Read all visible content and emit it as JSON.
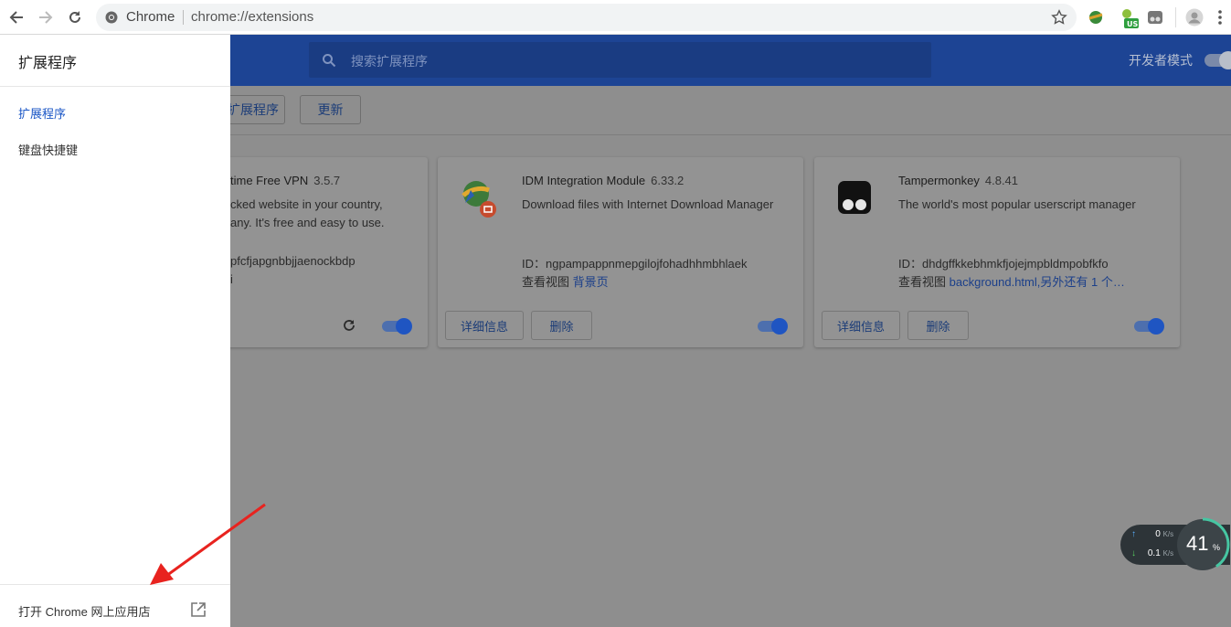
{
  "browser": {
    "site_name": "Chrome",
    "url": "chrome://extensions"
  },
  "header": {
    "search_placeholder": "搜索扩展程序",
    "dev_mode_label": "开发者模式"
  },
  "subbar": {
    "load_label": "扩展程序",
    "update_label": "更新"
  },
  "drawer": {
    "title": "扩展程序",
    "items": [
      {
        "label": "扩展程序"
      },
      {
        "label": "键盘快捷键"
      }
    ],
    "footer_label": "打开 Chrome 网上应用店"
  },
  "cards": [
    {
      "name": "time Free VPN",
      "version": "3.5.7",
      "desc_line1": "cked website in your country,",
      "desc_line2": "any. It's free and easy to use.",
      "id_text": "pfcfjapgnbbjjaenockbdp",
      "view_text": "i",
      "enabled": true
    },
    {
      "name": "IDM Integration Module",
      "version": "6.33.2",
      "desc": "Download files with Internet Download Manager",
      "id_label": "ID：",
      "id_text": "ngpampappnmepgilojfohadhhmbhlaek",
      "view_label": "查看视图",
      "view_link": "背景页",
      "details_label": "详细信息",
      "remove_label": "删除",
      "enabled": true
    },
    {
      "name": "Tampermonkey",
      "version": "4.8.41",
      "desc": "The world's most popular userscript manager",
      "id_label": "ID：",
      "id_text": "dhdgffkkebhmkfjojejmpbldmpobfkfo",
      "view_label": "查看视图",
      "view_link": "background.html,另外还有 1 个…",
      "details_label": "详细信息",
      "remove_label": "删除",
      "enabled": true
    }
  ],
  "netspeed": {
    "up_value": "0",
    "up_unit": "K/s",
    "down_value": "0.1",
    "down_unit": "K/s",
    "cpu_value": "41",
    "cpu_unit": "%"
  },
  "colors": {
    "header_blue": "#1d4494",
    "link_blue": "#1a56c6",
    "overlay_gray": "#8e8e8e"
  }
}
